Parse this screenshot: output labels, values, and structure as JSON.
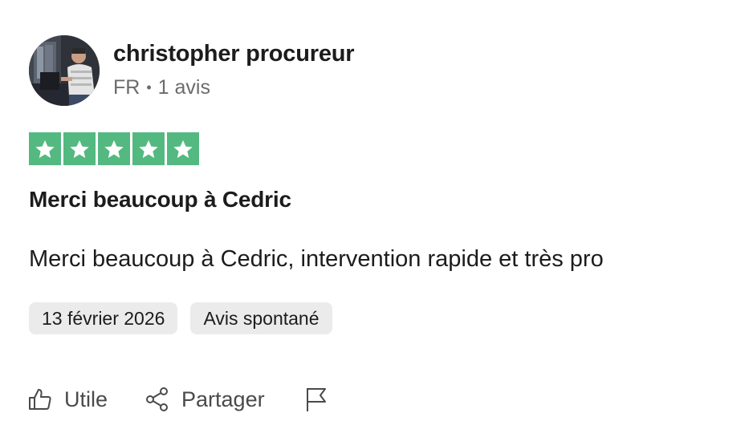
{
  "reviewer": {
    "name": "christopher procureur",
    "country": "FR",
    "separator": "•",
    "review_count": "1 avis"
  },
  "rating": {
    "stars": 5,
    "max": 5,
    "color": "#53b980"
  },
  "review": {
    "title": "Merci beaucoup à Cedric",
    "text": "Merci beaucoup à Cedric, intervention rapide et très pro"
  },
  "tags": [
    {
      "label": "13 février 2026"
    },
    {
      "label": "Avis spontané"
    }
  ],
  "actions": {
    "useful_label": "Utile",
    "share_label": "Partager"
  },
  "icons": {
    "useful": "thumbs-up-icon",
    "share": "share-icon",
    "report": "flag-icon",
    "star": "star-icon"
  }
}
